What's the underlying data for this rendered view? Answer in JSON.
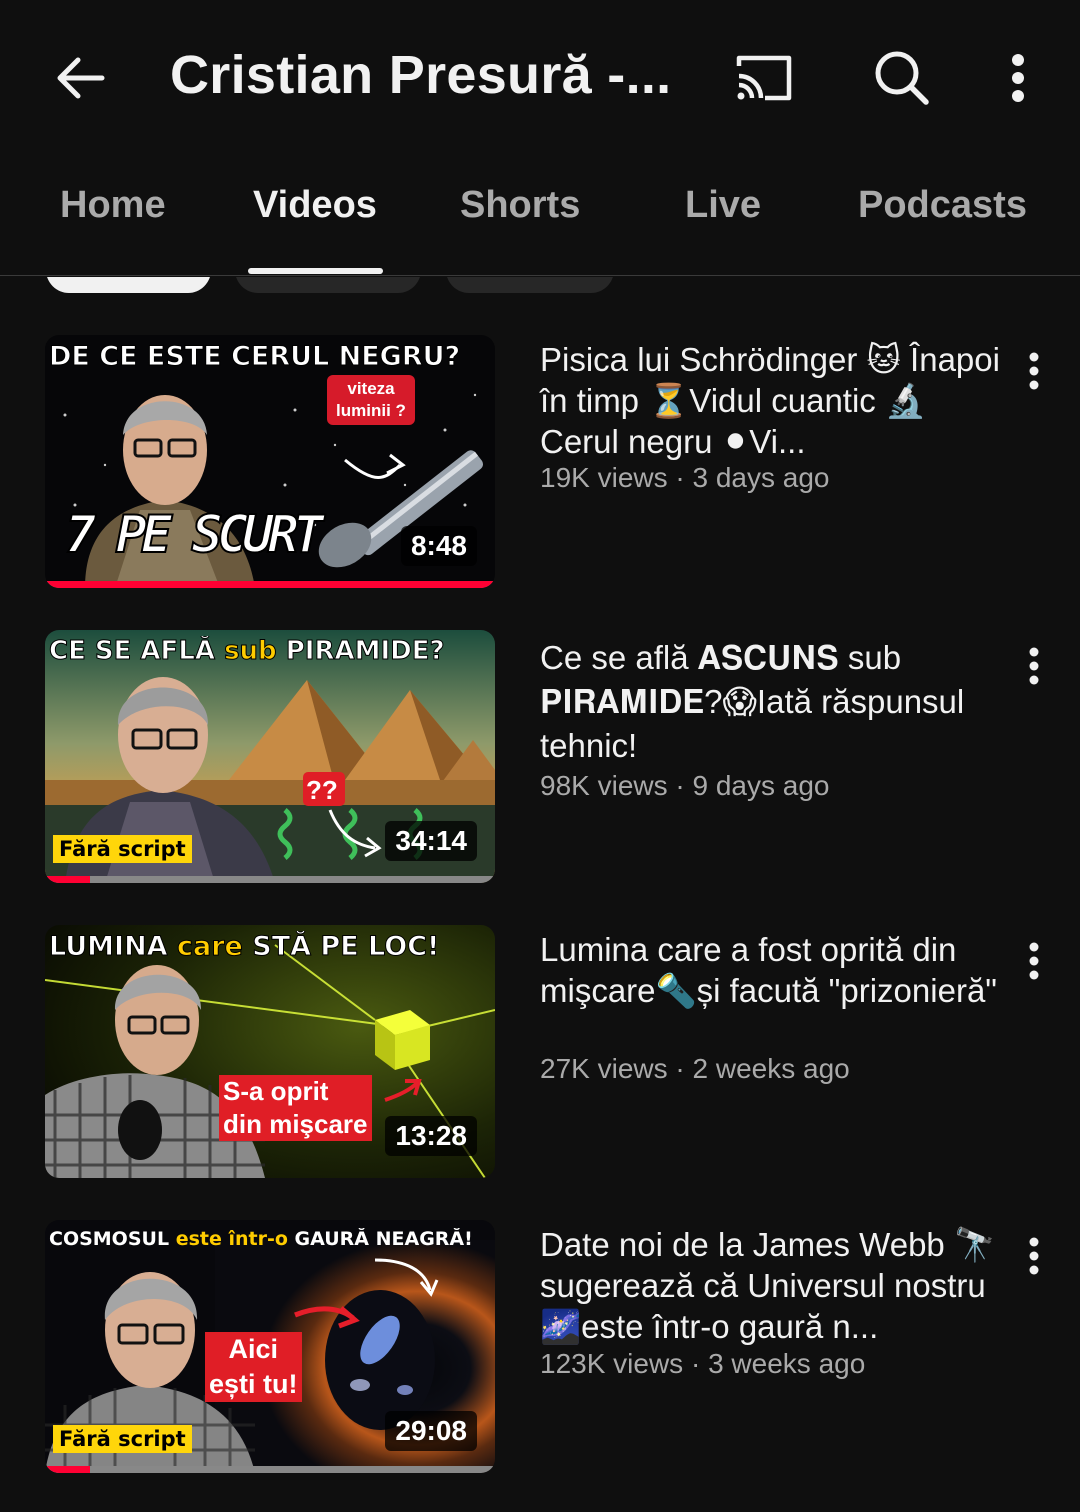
{
  "header": {
    "title": "Cristian Presură -...",
    "back_icon": "arrow-left-icon",
    "cast_icon": "cast-icon",
    "search_icon": "search-icon",
    "more_icon": "more-vert-icon"
  },
  "tabs": [
    {
      "label": "Home",
      "active": false
    },
    {
      "label": "Videos",
      "active": true
    },
    {
      "label": "Shorts",
      "active": false
    },
    {
      "label": "Live",
      "active": false
    },
    {
      "label": "Podcasts",
      "active": false
    }
  ],
  "videos": [
    {
      "title": "Pisica lui Schrödinger 🐱 Înapoi în timp ⏳Vidul cuantic 🔬Cerul negru ⚫Vi...",
      "meta": "19K views · 3 days ago",
      "duration": "8:48",
      "thumb_caption": "DE CE ESTE CERUL NEGRU?",
      "thumb_text_1": "viteza",
      "thumb_text_2": "luminii ?",
      "thumb_text_3": "7 PE SCURT",
      "progress": 1.0
    },
    {
      "title": "Ce se află 𝐀𝐒𝐂𝐔𝐍𝐒 sub 𝐏𝐈𝐑𝐀𝐌𝐈𝐃𝐄?😱Iată răspunsul tehnic!",
      "meta": "98K views · 9 days ago",
      "duration": "34:14",
      "thumb_caption_1": "CE SE AFLĂ ",
      "thumb_caption_2": "sub",
      "thumb_caption_3": " PIRAMIDE?",
      "thumb_text_1": "??",
      "badge": "Fără script",
      "progress": 0.1
    },
    {
      "title": "Lumina care a fost oprită din mişcare🔦și facută \"prizonieră\"",
      "meta": "27K views · 2 weeks ago",
      "duration": "13:28",
      "thumb_caption_1": "LUMINA ",
      "thumb_caption_2": "care",
      "thumb_caption_3": " STĂ PE LOC!",
      "thumb_text_1": "S-a oprit",
      "thumb_text_2": "din mişcare",
      "progress": 0.0
    },
    {
      "title": "Date noi de la James Webb 🔭 sugerează că Universul nostru 🌌este într-o gaură n...",
      "meta": "123K views · 3 weeks ago",
      "duration": "29:08",
      "thumb_caption_1": "COSMOSUL ",
      "thumb_caption_2": "este într-o",
      "thumb_caption_3": " GAURĂ NEAGRĂ!",
      "thumb_text_1": "Aici",
      "thumb_text_2": "ești tu!",
      "badge": "Fără script",
      "progress": 0.1
    }
  ],
  "colors": {
    "background": "#0f0f0f",
    "text_primary": "#f1f1f1",
    "text_secondary": "#aaaaaa",
    "progress_red": "#ff0033",
    "badge_yellow": "#ffd60a"
  }
}
